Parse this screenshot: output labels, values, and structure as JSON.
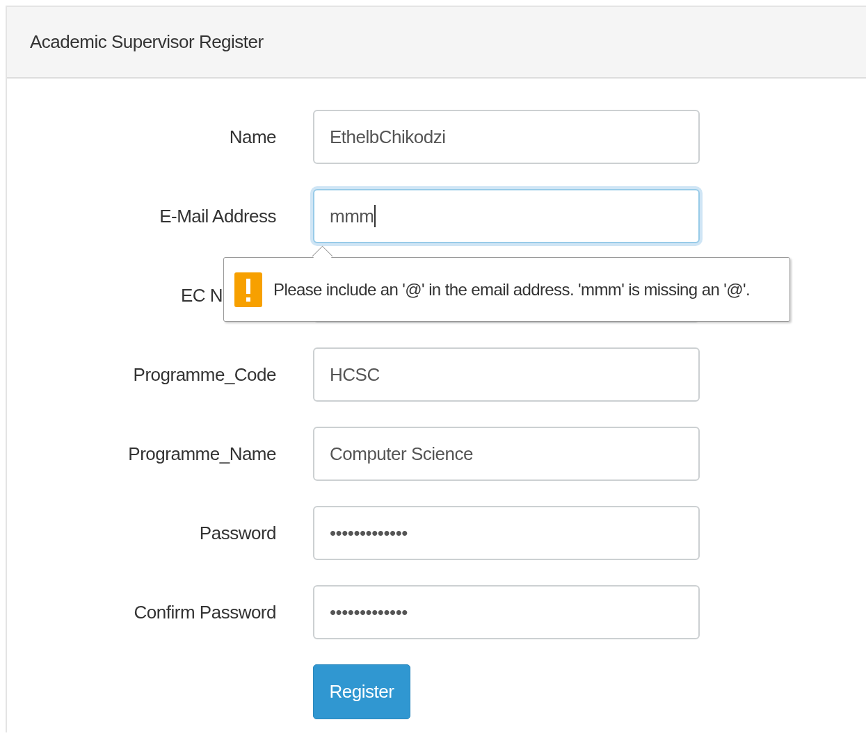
{
  "panel": {
    "title": "Academic Supervisor Register"
  },
  "fields": [
    {
      "label": "Name",
      "value": "EthelbChikodzi",
      "focused": false
    },
    {
      "label": "E-Mail Address",
      "value": "mmm",
      "focused": true,
      "validation_message": "Please include an '@' in the email address. 'mmm' is missing an '@'."
    },
    {
      "label": "EC N",
      "focused": false
    },
    {
      "label": "Programme_Code",
      "value": "HCSC",
      "focused": false
    },
    {
      "label": "Programme_Name",
      "value": "Computer Science",
      "focused": false
    },
    {
      "label": "Password",
      "value": "•••••••••••••",
      "focused": false
    },
    {
      "label": "Confirm Password",
      "value": "•••••••••••••",
      "focused": false
    }
  ],
  "submit_button": "Register"
}
